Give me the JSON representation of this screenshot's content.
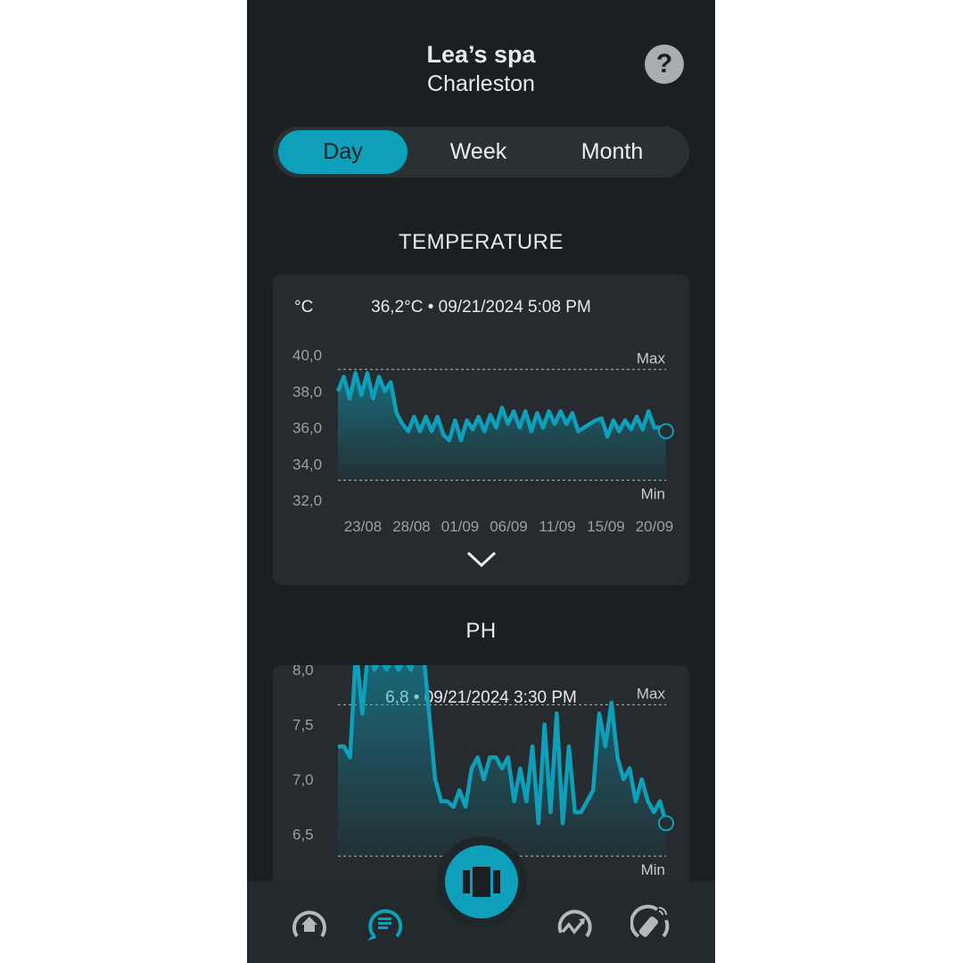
{
  "header": {
    "title": "Lea’s spa",
    "subtitle": "Charleston",
    "help_icon": "question-icon"
  },
  "tabs": [
    {
      "label": "Day",
      "active": true
    },
    {
      "label": "Week",
      "active": false
    },
    {
      "label": "Month",
      "active": false
    }
  ],
  "accent": "#0ea0bb",
  "temperature": {
    "section_title": "TEMPERATURE",
    "unit": "°C",
    "readout": "36,2°C • 09/21/2024 5:08 PM",
    "chart_data": {
      "type": "area",
      "y_ticks": [
        "40,0",
        "38,0",
        "36,0",
        "34,0",
        "32,0"
      ],
      "ylim": [
        32,
        40
      ],
      "x_ticks": [
        "23/08",
        "28/08",
        "01/09",
        "06/09",
        "11/09",
        "15/09",
        "20/09"
      ],
      "max_label": "Max",
      "min_label": "Min",
      "max": 39.2,
      "min": 33.1,
      "values": [
        38.0,
        38.8,
        37.6,
        39.0,
        37.8,
        39.0,
        37.6,
        38.8,
        38.0,
        38.5,
        36.8,
        36.2,
        35.8,
        36.6,
        35.8,
        36.6,
        35.8,
        36.6,
        35.6,
        35.3,
        36.4,
        35.3,
        36.4,
        35.9,
        36.6,
        35.8,
        36.7,
        36.0,
        37.1,
        36.2,
        36.9,
        36.0,
        36.9,
        35.8,
        36.8,
        36.0,
        36.9,
        36.2,
        36.9,
        36.2,
        36.8,
        35.8,
        36.0,
        36.2,
        36.4,
        36.5,
        35.5,
        36.4,
        35.8,
        36.4,
        35.9,
        36.6,
        35.9,
        36.9,
        36.0,
        36.0,
        35.8
      ]
    }
  },
  "ph": {
    "section_title": "PH",
    "readout": "6,8 •  09/21/2024 3:30 PM",
    "chart_data": {
      "type": "area",
      "y_ticks": [
        "8,0",
        "7,5",
        "7,0",
        "6,5"
      ],
      "ylim": [
        6.0,
        8.0
      ],
      "max_label": "Max",
      "min_label": "Min",
      "max": 7.68,
      "min": 6.3,
      "values": [
        7.3,
        7.3,
        7.2,
        8.2,
        7.6,
        8.2,
        8.0,
        8.1,
        8.0,
        8.1,
        8.0,
        8.1,
        8.0,
        8.2,
        8.2,
        7.6,
        7.0,
        6.8,
        6.8,
        6.75,
        6.9,
        6.75,
        7.1,
        7.2,
        7.0,
        7.2,
        7.2,
        7.1,
        7.2,
        6.8,
        7.1,
        6.8,
        7.3,
        6.6,
        7.5,
        6.7,
        7.6,
        6.6,
        7.3,
        6.7,
        6.7,
        6.8,
        6.9,
        7.6,
        7.3,
        7.7,
        7.2,
        7.0,
        7.1,
        6.8,
        7.0,
        6.8,
        6.7,
        6.8,
        6.6
      ]
    }
  },
  "expand_icon": "chevron-down-icon",
  "nav": {
    "items": [
      "home-icon",
      "messages-icon",
      "pool-icon",
      "stats-icon",
      "remote-icon"
    ],
    "active": "messages-icon"
  }
}
